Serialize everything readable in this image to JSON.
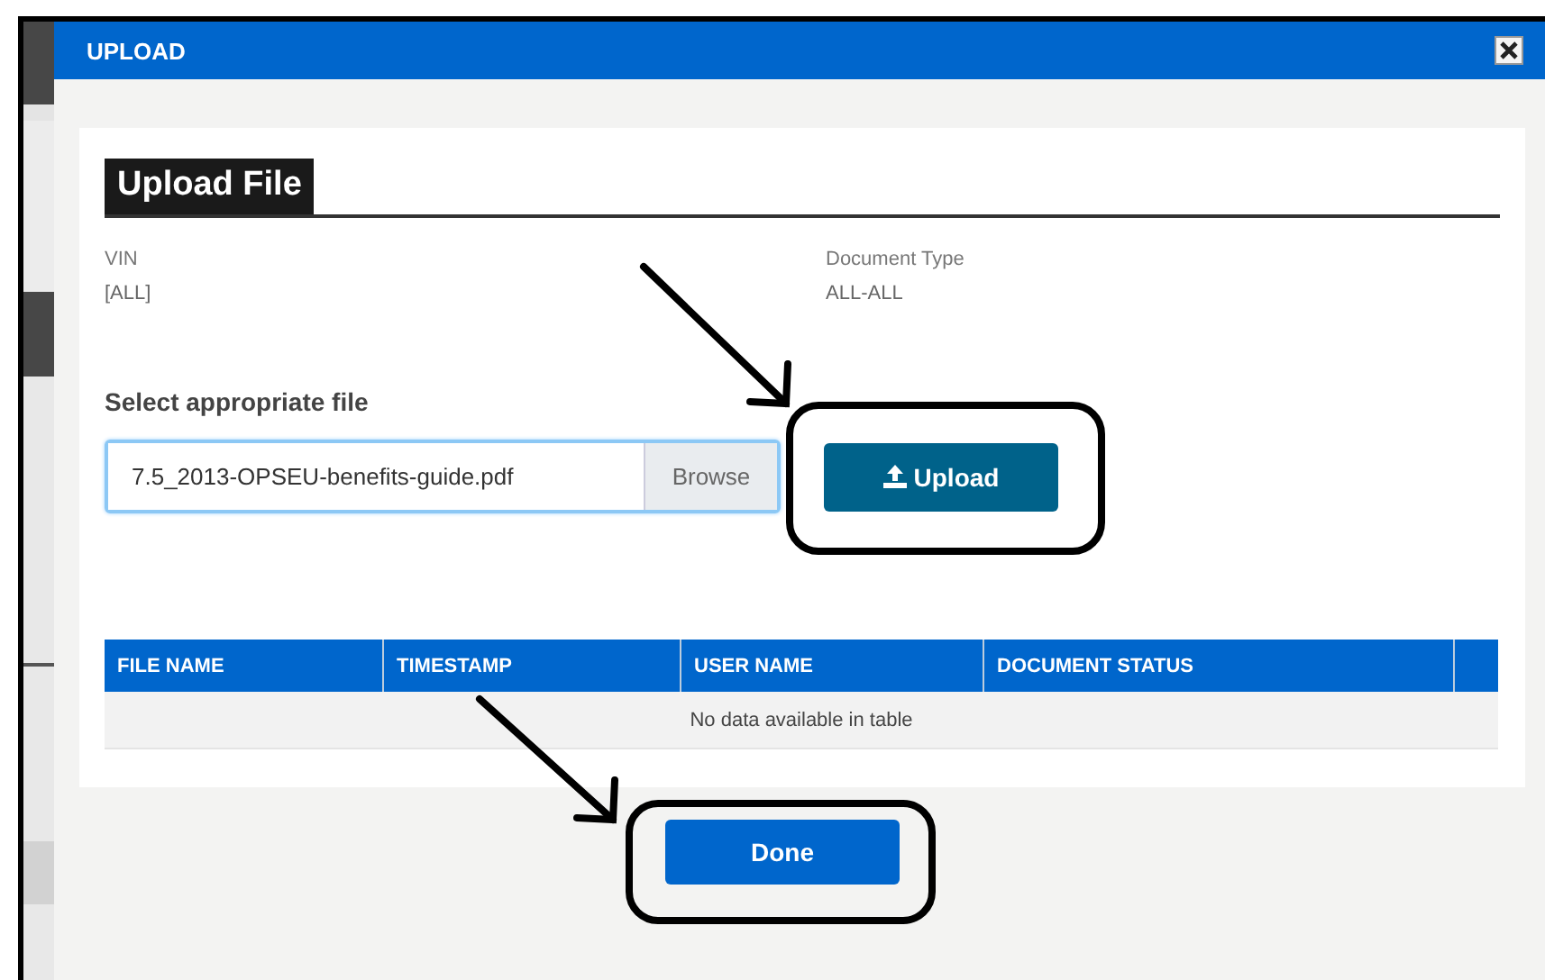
{
  "dialog": {
    "title": "UPLOAD"
  },
  "section": {
    "heading": "Upload File"
  },
  "fields": [
    {
      "label": "VIN",
      "value": "[ALL]"
    },
    {
      "label": "Document Type",
      "value": "ALL-ALL"
    }
  ],
  "file_picker": {
    "label": "Select appropriate file",
    "value": "7.5_2013-OPSEU-benefits-guide.pdf",
    "browse_label": "Browse"
  },
  "upload_button": {
    "label": "Upload"
  },
  "table": {
    "columns": [
      "FILE NAME",
      "TIMESTAMP",
      "USER NAME",
      "DOCUMENT STATUS"
    ],
    "empty_message": "No data available in table"
  },
  "done_button": {
    "label": "Done"
  }
}
